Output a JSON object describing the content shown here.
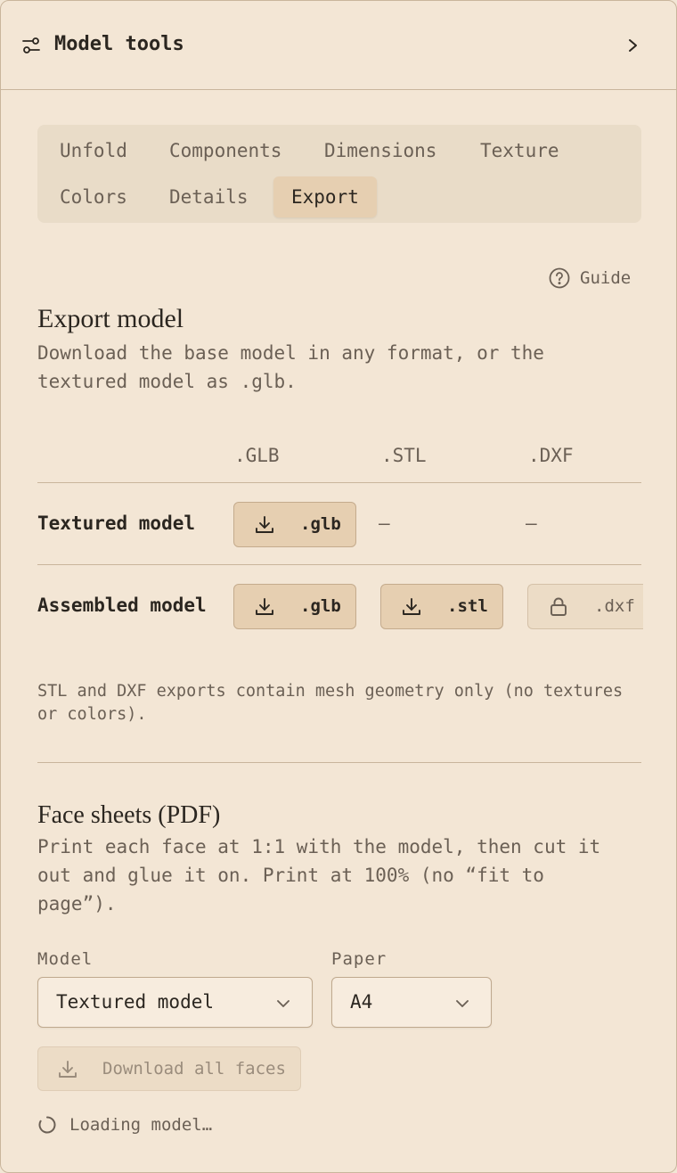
{
  "header": {
    "title": "Model tools",
    "tools_icon": "sliders-icon",
    "expand_icon": "chevron-right-icon"
  },
  "tabs": [
    {
      "label": "Unfold",
      "active": false
    },
    {
      "label": "Components",
      "active": false
    },
    {
      "label": "Dimensions",
      "active": false
    },
    {
      "label": "Texture",
      "active": false
    },
    {
      "label": "Colors",
      "active": false
    },
    {
      "label": "Details",
      "active": false
    },
    {
      "label": "Export",
      "active": true
    }
  ],
  "guide": {
    "label": "Guide",
    "icon": "help-circle-icon"
  },
  "export": {
    "title": "Export model",
    "description": "Download the base model in any format, or the textured model as .glb.",
    "columns": [
      ".GLB",
      ".STL",
      ".DXF"
    ],
    "rows": [
      {
        "label": "Textured model",
        "cells": [
          {
            "type": "button",
            "label": ".glb",
            "icon": "download-icon"
          },
          {
            "type": "dash",
            "text": "—"
          },
          {
            "type": "dash",
            "text": "—"
          }
        ]
      },
      {
        "label": "Assembled model",
        "cells": [
          {
            "type": "button",
            "label": ".glb",
            "icon": "download-icon"
          },
          {
            "type": "button",
            "label": ".stl",
            "icon": "download-icon"
          },
          {
            "type": "locked",
            "label": ".dxf",
            "icon": "lock-icon"
          }
        ]
      }
    ],
    "note": "STL and DXF exports contain mesh geometry only (no textures or colors)."
  },
  "face_sheets": {
    "title": "Face sheets (PDF)",
    "description": "Print each face at 1:1 with the model, then cut it out and glue it on. Print at 100% (no “fit to page”).",
    "model_label": "Model",
    "model_value": "Textured model",
    "paper_label": "Paper",
    "paper_value": "A4",
    "download_all_label": "Download all faces",
    "loading_text": "Loading model…"
  },
  "colors": {
    "background": "#f3e6d5",
    "accent_button": "#e6cfb1",
    "border": "#c9b59c",
    "muted_text": "#6b6055"
  }
}
